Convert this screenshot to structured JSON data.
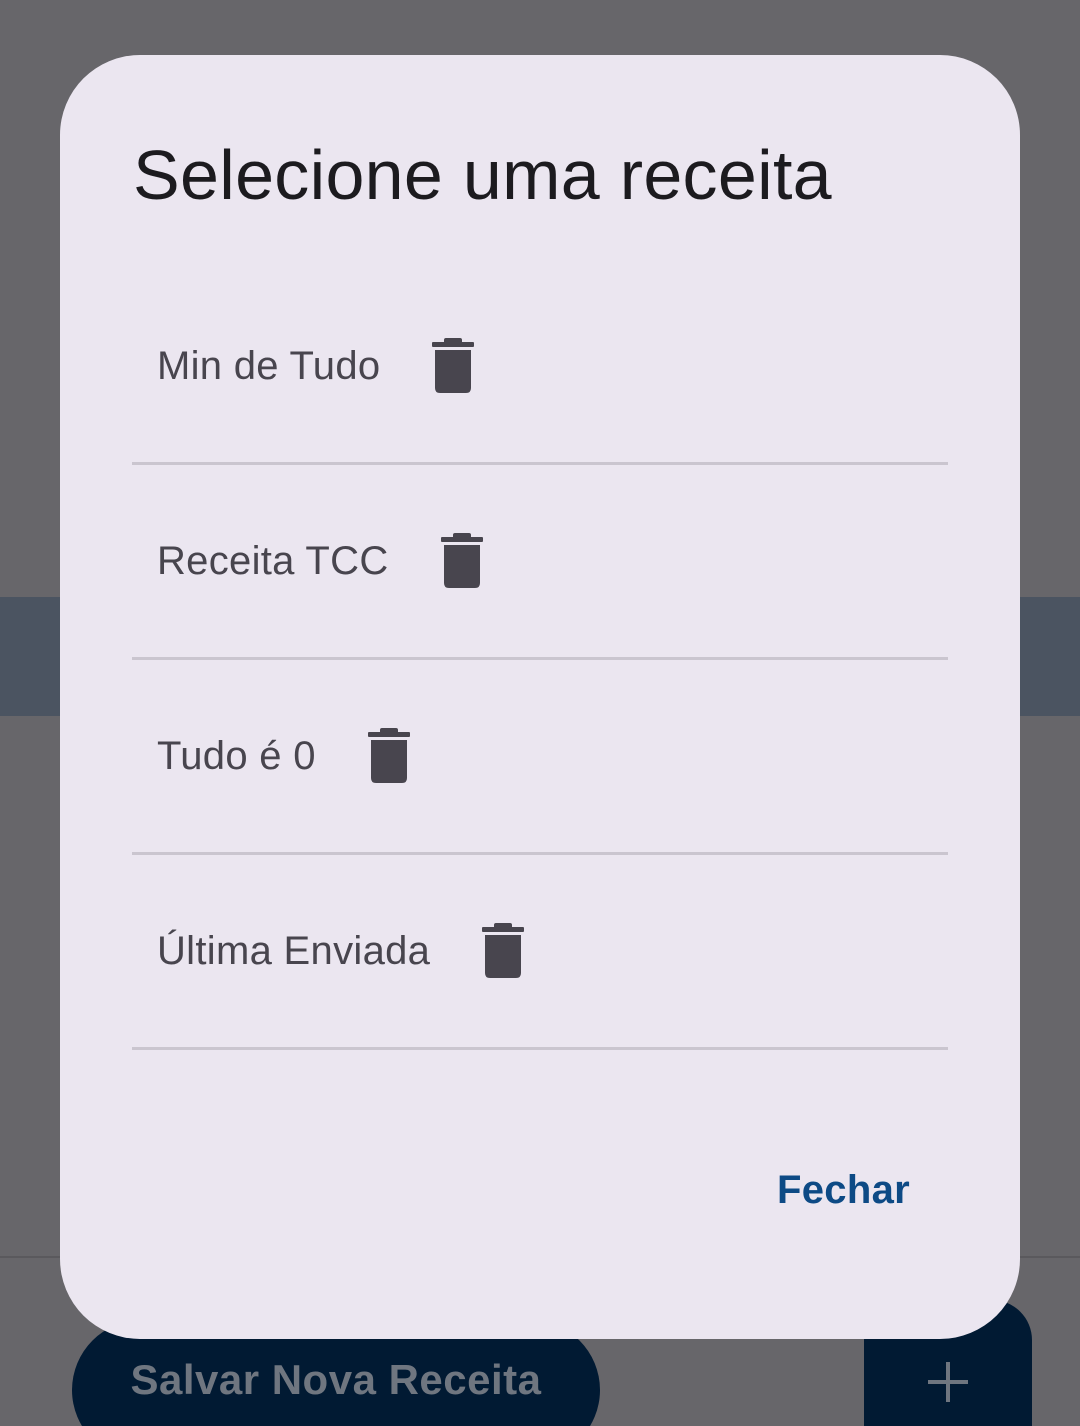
{
  "background": {
    "save_button_label": "Salvar Nova Receita",
    "fab_icon": "plus-icon"
  },
  "dialog": {
    "title": "Selecione uma receita",
    "recipes": [
      {
        "name": "Min de Tudo",
        "delete_icon": "trash-icon"
      },
      {
        "name": "Receita TCC",
        "delete_icon": "trash-icon"
      },
      {
        "name": "Tudo é 0",
        "delete_icon": "trash-icon"
      },
      {
        "name": "Última Enviada",
        "delete_icon": "trash-icon"
      }
    ],
    "close_label": "Fechar"
  },
  "colors": {
    "scrim": "#67666a",
    "dialog_surface": "#ebe6f0",
    "primary_text": "#1c1b1f",
    "item_text": "#48454e",
    "icon": "#48454e",
    "accent": "#0d4a85",
    "button_dark": "#011a33"
  }
}
